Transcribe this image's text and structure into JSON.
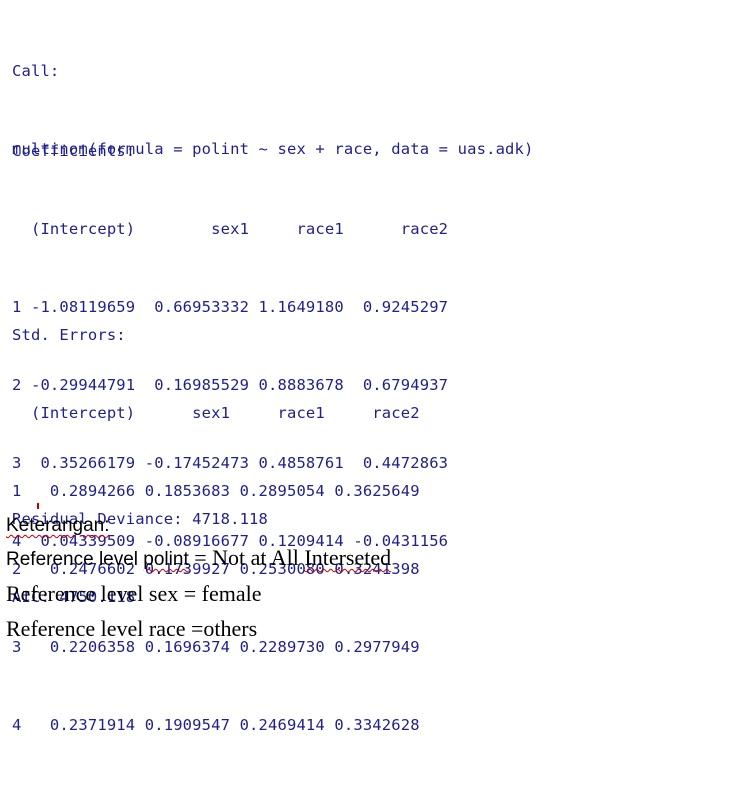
{
  "console": {
    "call_header": "Call:",
    "call_line": "multinom(formula = polint ~ sex + race, data = uas.adk)",
    "coefficients": {
      "title": "Coefficients:",
      "header": "  (Intercept)        sex1     race1      race2",
      "rows": [
        "1 -1.08119659  0.66953332 1.1649180  0.9245297",
        "2 -0.29944791  0.16985529 0.8883678  0.6794937",
        "3  0.35266179 -0.17452473 0.4858761  0.4472863",
        "4  0.04339509 -0.08916677 0.1209414 -0.0431156"
      ]
    },
    "std_errors": {
      "title": "Std. Errors:",
      "header": "  (Intercept)      sex1     race1     race2",
      "rows": [
        "1   0.2894266 0.1853683 0.2895054 0.3625649",
        "2   0.2476602 0.1739927 0.2530080 0.3241398",
        "3   0.2206358 0.1696374 0.2289730 0.2977949",
        "4   0.2371914 0.1909547 0.2469414 0.3342628"
      ]
    },
    "residual_deviance": "Residual Deviance: 4718.118",
    "aic": "AIC: 4750.118"
  },
  "notes": {
    "heading": "Keterangan:",
    "line1_prefix": "Reference level ",
    "line1_word": "polint",
    "line1_eq": " = Not at All ",
    "line1_tail": "Interseted",
    "line2": "Reference level sex = female",
    "line3": "Reference level race =others"
  },
  "colors": {
    "console_text": "#1f1f8f",
    "spellcheck_underline": "#c00000"
  }
}
